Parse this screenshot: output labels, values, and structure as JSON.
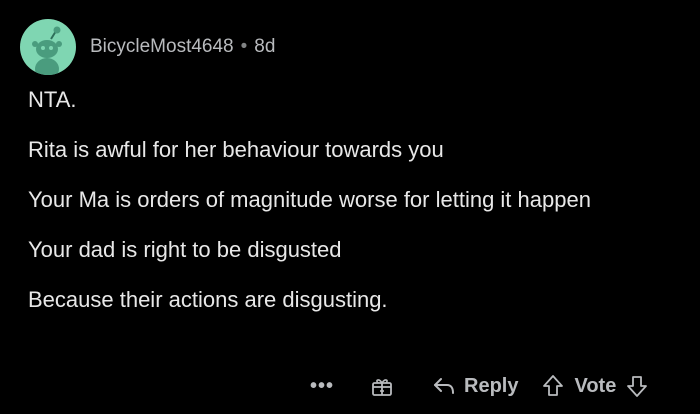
{
  "comment": {
    "author": "BicycleMost4648",
    "separator": "•",
    "age": "8d",
    "paragraphs": [
      "NTA.",
      "Rita is awful for her behaviour towards you",
      "Your Ma is orders of magnitude worse for letting it happen",
      "Your dad is right to be disgusted",
      "Because their actions are disgusting."
    ]
  },
  "actions": {
    "more": "•••",
    "reply_label": "Reply",
    "vote_label": "Vote"
  },
  "icons": {
    "avatar": "snoo-avatar-icon",
    "more": "more-options-icon",
    "award": "award-gift-icon",
    "reply": "reply-arrow-icon",
    "upvote": "upvote-arrow-icon",
    "downvote": "downvote-arrow-icon"
  },
  "colors": {
    "background": "#000000",
    "avatar_bg": "#7fd6b2",
    "text": "#e8e8e8",
    "muted": "#b9bbbe"
  }
}
